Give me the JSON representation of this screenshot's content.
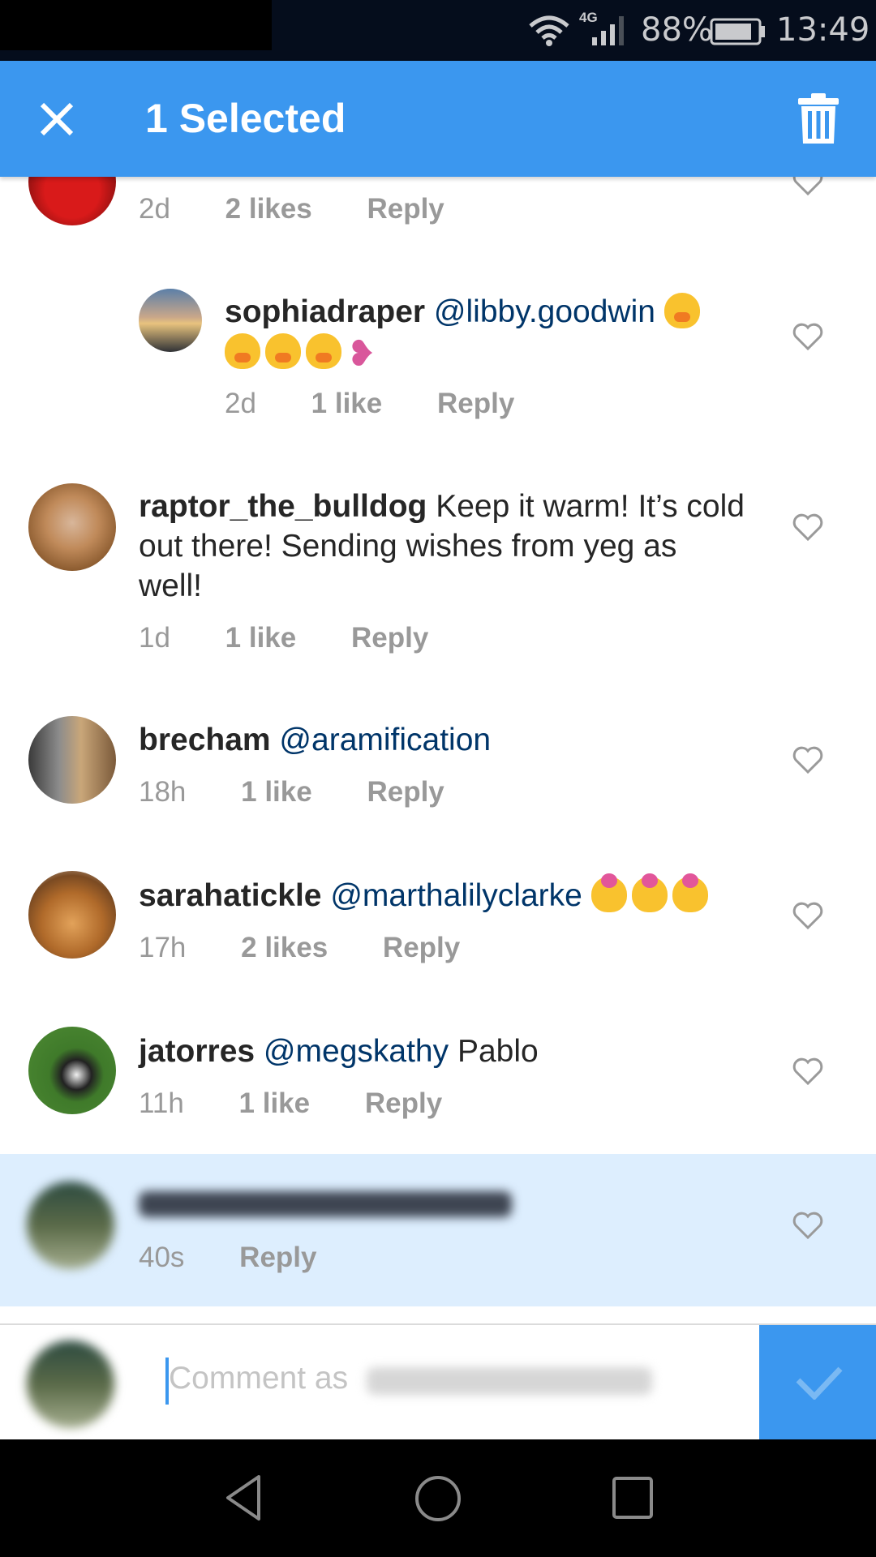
{
  "status_bar": {
    "network": "4G",
    "battery_percent": "88%",
    "time": "13:49",
    "icons": [
      "wifi-icon",
      "signal-icon",
      "battery-icon"
    ]
  },
  "app_bar": {
    "close_icon": "close-icon",
    "title": "1 Selected",
    "delete_icon": "trash-icon"
  },
  "comments": [
    {
      "username": "",
      "text": "",
      "time": "2d",
      "likes": "2 likes",
      "reply_label": "Reply",
      "partial": true
    },
    {
      "username": "sophiadraper",
      "mention": "@libby.goodwin",
      "text": "",
      "emojis": [
        "flushed-face",
        "flushed-face",
        "flushed-face",
        "flushed-face",
        "two-hearts"
      ],
      "time": "2d",
      "likes": "1 like",
      "reply_label": "Reply",
      "is_reply": true
    },
    {
      "username": "raptor_the_bulldog",
      "text_line1": "Keep it warm! It’s cold",
      "text_line2": "out there! Sending wishes from yeg as",
      "text_line3": "well!",
      "time": "1d",
      "likes": "1 like",
      "reply_label": "Reply"
    },
    {
      "username": "brecham",
      "mention": "@aramification",
      "time": "18h",
      "likes": "1 like",
      "reply_label": "Reply"
    },
    {
      "username": "sarahatickle",
      "mention": "@marthalilyclarke",
      "emojis": [
        "kissing-face",
        "kissing-face",
        "kissing-face"
      ],
      "time": "17h",
      "likes": "2 likes",
      "reply_label": "Reply"
    },
    {
      "username": "jatorres",
      "mention": "@megskathy",
      "text": "Pablo",
      "time": "11h",
      "likes": "1 like",
      "reply_label": "Reply"
    },
    {
      "username": "[blurred]",
      "time": "40s",
      "reply_label": "Reply",
      "selected": true
    }
  ],
  "composer": {
    "placeholder": "Comment as",
    "placeholder_user": "[blurred]",
    "send_icon": "check-icon"
  },
  "nav_bar": {
    "buttons": [
      "back",
      "home",
      "recents"
    ]
  },
  "colors": {
    "accent": "#3b97ef",
    "selected_row": "#ddeefe",
    "mention": "#003569",
    "meta_text": "#999999",
    "username": "#262626"
  }
}
